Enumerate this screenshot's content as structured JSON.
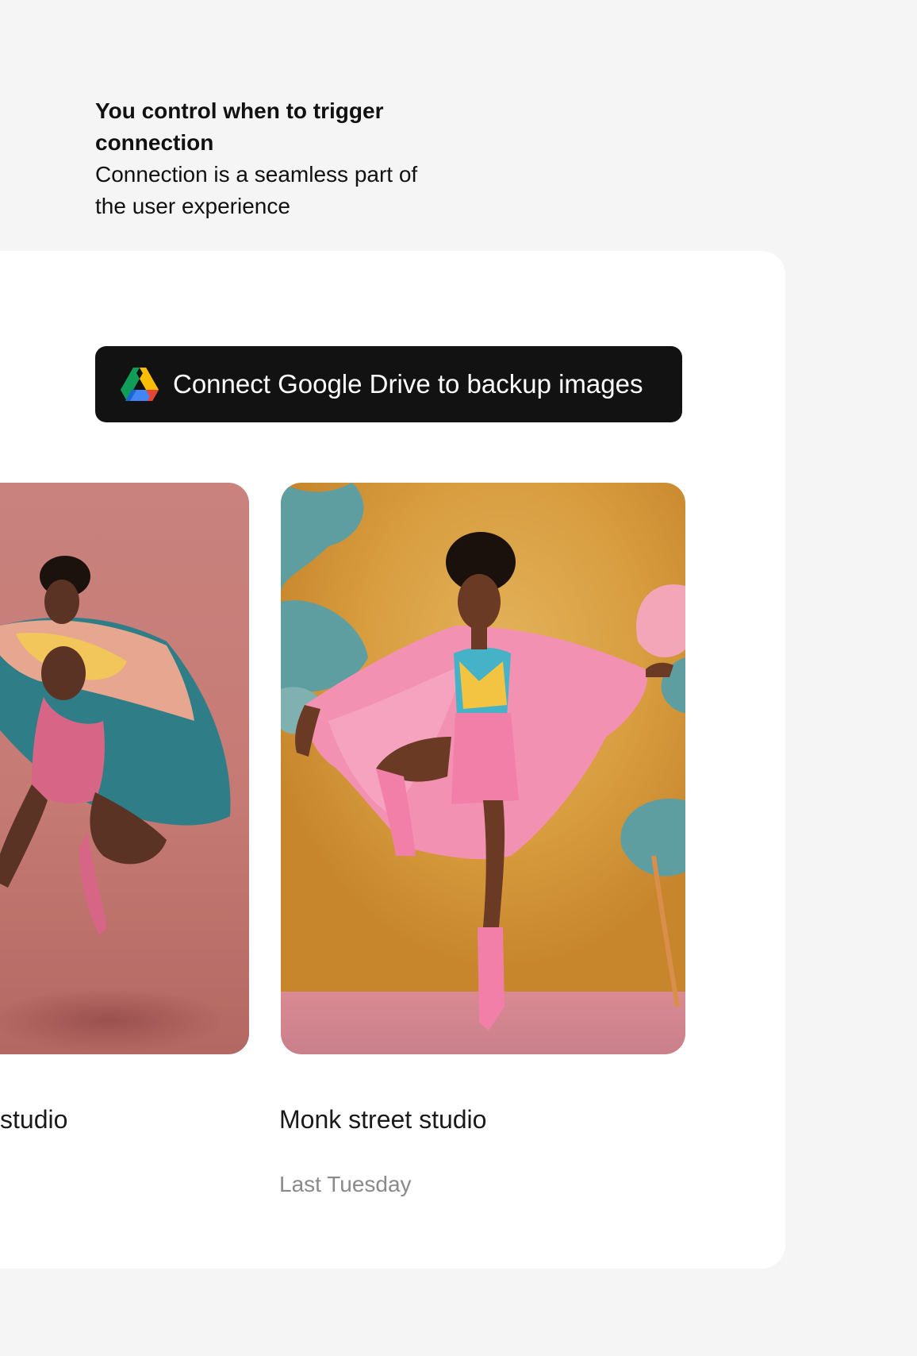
{
  "intro": {
    "title": "You control when to trigger connection",
    "description": "Connection is a seamless part of the user experience"
  },
  "connect_button": {
    "label": "Connect Google Drive to backup images",
    "icon": "google-drive-icon"
  },
  "gallery": {
    "items": [
      {
        "name": "studio",
        "date": ""
      },
      {
        "name": "Monk street studio",
        "date": "Last Tuesday"
      }
    ]
  },
  "colors": {
    "background": "#f5f5f5",
    "card": "#ffffff",
    "button": "#121212",
    "button_text": "#ffffff",
    "secondary_text": "#8a8a8a"
  }
}
